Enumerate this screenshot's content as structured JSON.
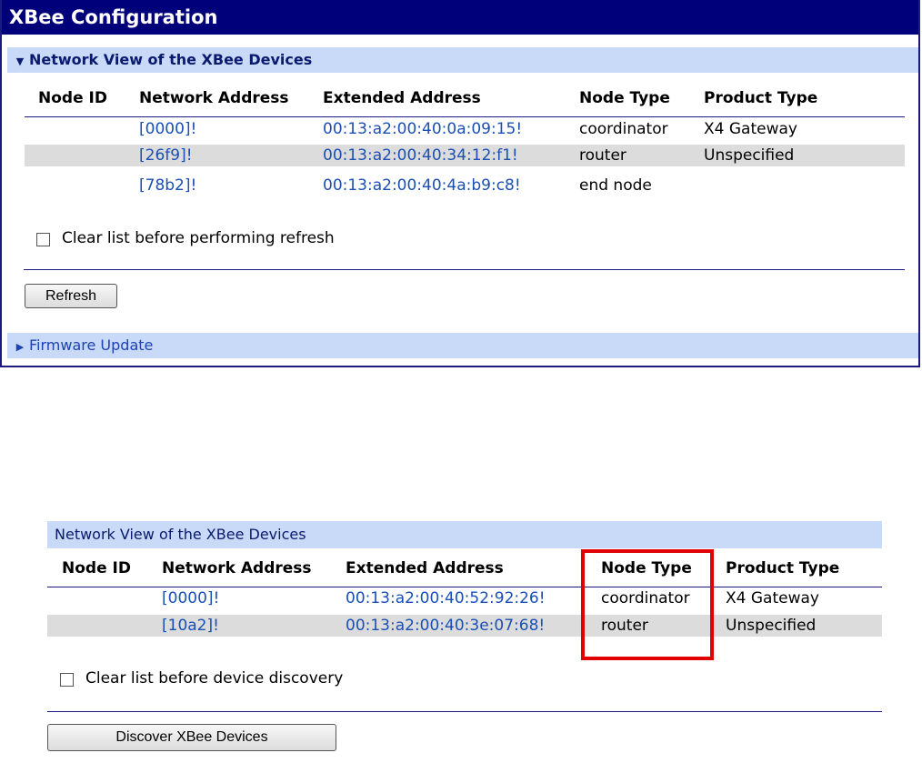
{
  "panel1": {
    "title": "XBee Configuration",
    "section_title": "Network View of the XBee Devices",
    "columns": [
      "Node ID",
      "Network Address",
      "Extended Address",
      "Node Type",
      "Product Type"
    ],
    "rows": [
      {
        "node_id": "",
        "network_address": "[0000]!",
        "extended_address": "00:13:a2:00:40:0a:09:15!",
        "node_type": "coordinator",
        "product_type": "X4 Gateway"
      },
      {
        "node_id": "",
        "network_address": "[26f9]!",
        "extended_address": "00:13:a2:00:40:34:12:f1!",
        "node_type": "router",
        "product_type": "Unspecified"
      },
      {
        "node_id": "",
        "network_address": "[78b2]!",
        "extended_address": "00:13:a2:00:40:4a:b9:c8!",
        "node_type": "end node",
        "product_type": ""
      }
    ],
    "checkbox_label": "Clear list before performing refresh",
    "checkbox_checked": false,
    "refresh_button": "Refresh",
    "firmware_section": "Firmware Update"
  },
  "panel2": {
    "section_title": "Network View of the XBee Devices",
    "columns": [
      "Node ID",
      "Network Address",
      "Extended Address",
      "Node Type",
      "Product Type"
    ],
    "rows": [
      {
        "node_id": "",
        "network_address": "[0000]!",
        "extended_address": "00:13:a2:00:40:52:92:26!",
        "node_type": "coordinator",
        "product_type": "X4 Gateway"
      },
      {
        "node_id": "",
        "network_address": "[10a2]!",
        "extended_address": "00:13:a2:00:40:3e:07:68!",
        "node_type": "router",
        "product_type": "Unspecified"
      }
    ],
    "checkbox_label": "Clear list before device discovery",
    "checkbox_checked": false,
    "discover_button": "Discover XBee Devices",
    "highlight_color": "#e00000"
  },
  "colors": {
    "title_bar": "#00007a",
    "section_bg": "#c9d9f8",
    "alt_row": "#dcdcdc",
    "link": "#1a4fb5"
  }
}
